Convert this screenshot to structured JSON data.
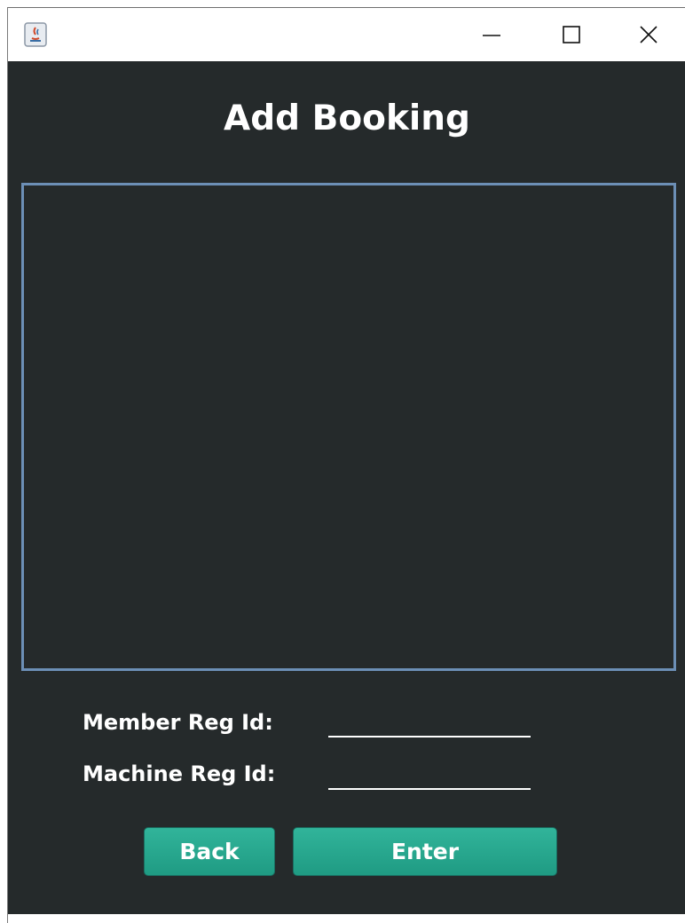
{
  "window": {
    "controls": {
      "minimize": "minimize-icon",
      "maximize": "maximize-icon",
      "close": "close-icon"
    }
  },
  "page": {
    "title": "Add Booking"
  },
  "form": {
    "member_label": "Member Reg Id:",
    "member_value": "",
    "machine_label": "Machine Reg Id:",
    "machine_value": ""
  },
  "buttons": {
    "back": "Back",
    "enter": "Enter"
  },
  "colors": {
    "background": "#252a2b",
    "panel_border": "#6c8fb6",
    "button": "#27a88e",
    "text": "#ffffff"
  }
}
